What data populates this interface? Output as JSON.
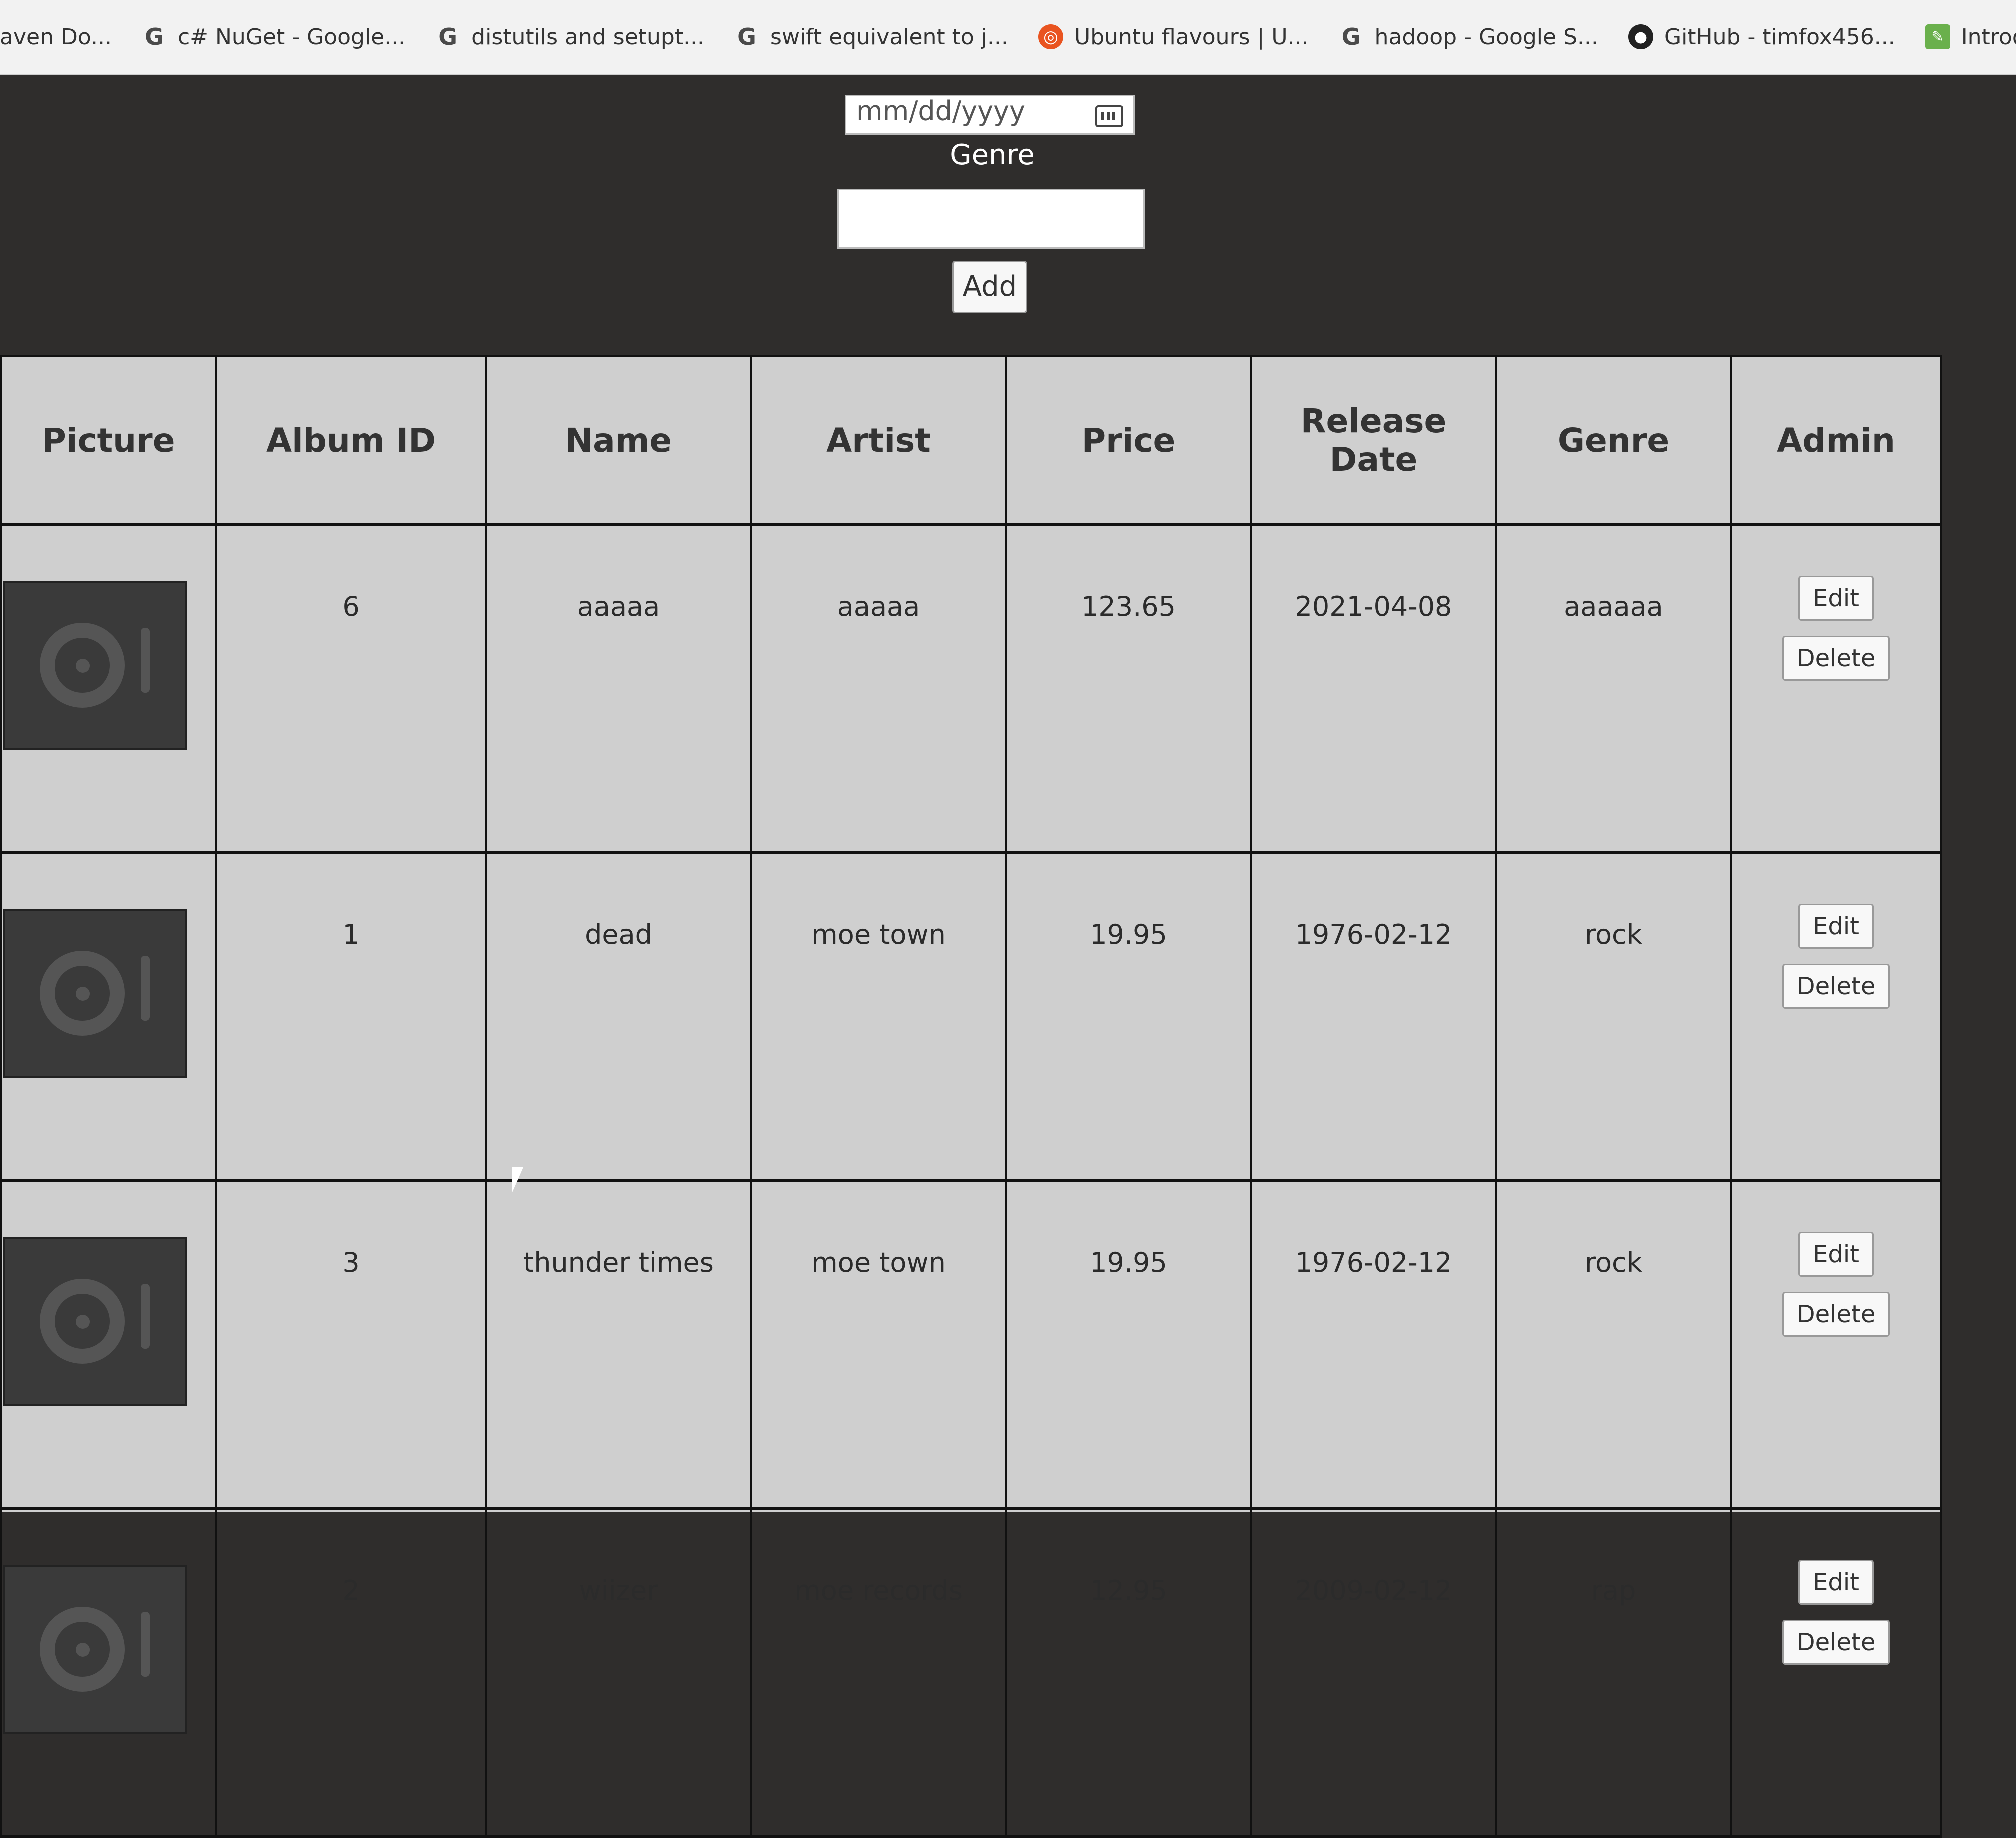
{
  "bookmarks": [
    {
      "label": "aven Do...",
      "icon": "maven-icon"
    },
    {
      "label": "c# NuGet - Google...",
      "icon": "google-icon"
    },
    {
      "label": "distutils and setupt...",
      "icon": "google-icon"
    },
    {
      "label": "swift equivalent to j...",
      "icon": "google-icon"
    },
    {
      "label": "Ubuntu flavours | U...",
      "icon": "ubuntu-icon"
    },
    {
      "label": "hadoop - Google S...",
      "icon": "google-icon"
    },
    {
      "label": "GitHub - timfox456...",
      "icon": "github-icon"
    },
    {
      "label": "Introduction to Jav...",
      "icon": "leaf-icon"
    }
  ],
  "form": {
    "date_placeholder": "mm/dd/yyyy",
    "genre_label": "Genre",
    "genre_value": "",
    "add_label": "Add"
  },
  "table": {
    "headers": [
      "Picture",
      "Album ID",
      "Name",
      "Artist",
      "Price",
      "Release Date",
      "Genre",
      "Admin"
    ],
    "rows": [
      {
        "id": "6",
        "name": "aaaaa",
        "artist": "aaaaa",
        "price": "123.65",
        "date": "2021-04-08",
        "genre": "aaaaaa",
        "edit": "Edit",
        "delete": "Delete"
      },
      {
        "id": "1",
        "name": "dead",
        "artist": "moe town",
        "price": "19.95",
        "date": "1976-02-12",
        "genre": "rock",
        "edit": "Edit",
        "delete": "Delete"
      },
      {
        "id": "3",
        "name": "thunder times",
        "artist": "moe town",
        "price": "19.95",
        "date": "1976-02-12",
        "genre": "rock",
        "edit": "Edit",
        "delete": "Delete"
      },
      {
        "id": "2",
        "name": "wiizer",
        "artist": "moe records",
        "price": "12.95",
        "date": "2009-02-12",
        "genre": "rap",
        "edit": "Edit",
        "delete": "Delete"
      }
    ]
  },
  "colors": {
    "page_bg": "#2f2d2c",
    "table_bg": "#cfcfcf",
    "border": "#111111"
  }
}
